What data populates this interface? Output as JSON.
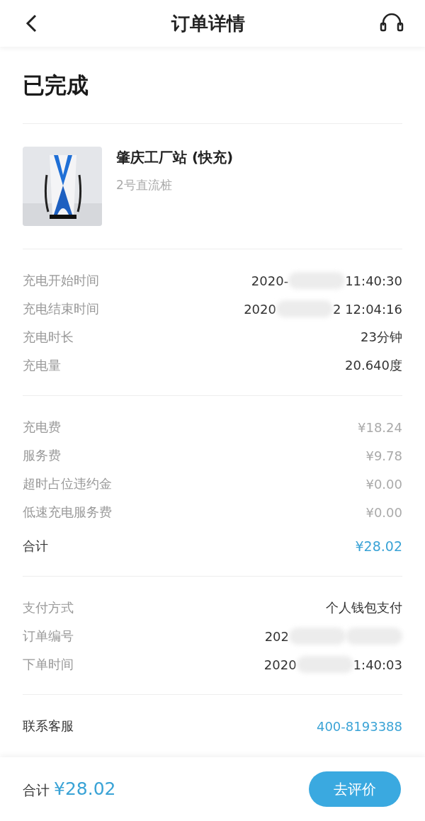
{
  "header": {
    "title": "订单详情"
  },
  "status": "已完成",
  "station": {
    "name": "肇庆工厂站 (快充)",
    "pile": "2号直流桩"
  },
  "sections": [
    {
      "rows": [
        {
          "kind": "detail",
          "label": "充电开始时间",
          "value": "2020-",
          "value_end": "11:40:30"
        },
        {
          "kind": "detail",
          "label": "充电结束时间",
          "value": "2020",
          "value_end": "2 12:04:16"
        },
        {
          "kind": "detail",
          "label": "充电时长",
          "value": "23分钟"
        },
        {
          "kind": "detail",
          "label": "充电量",
          "value": "20.640度"
        }
      ]
    },
    {
      "rows": [
        {
          "kind": "fee",
          "label": "充电费",
          "value": "¥18.24"
        },
        {
          "kind": "fee",
          "label": "服务费",
          "value": "¥9.78"
        },
        {
          "kind": "fee",
          "label": "超时占位违约金",
          "value": "¥0.00"
        },
        {
          "kind": "fee",
          "label": "低速充电服务费",
          "value": "¥0.00"
        },
        {
          "kind": "total",
          "label": "合计",
          "value": "¥28.02"
        }
      ]
    },
    {
      "rows": [
        {
          "kind": "detail",
          "label": "支付方式",
          "value": "个人钱包支付"
        },
        {
          "kind": "detail",
          "label": "订单编号",
          "value": "202",
          "value_end": ""
        },
        {
          "kind": "detail",
          "label": "下单时间",
          "value": "2020",
          "value_end": "1:40:03"
        }
      ]
    },
    {
      "rows": [
        {
          "kind": "link",
          "label": "联系客服",
          "value": "400-8193388"
        }
      ]
    }
  ],
  "footer": {
    "label": "合计",
    "amount": "¥28.02",
    "button": "去评价"
  }
}
